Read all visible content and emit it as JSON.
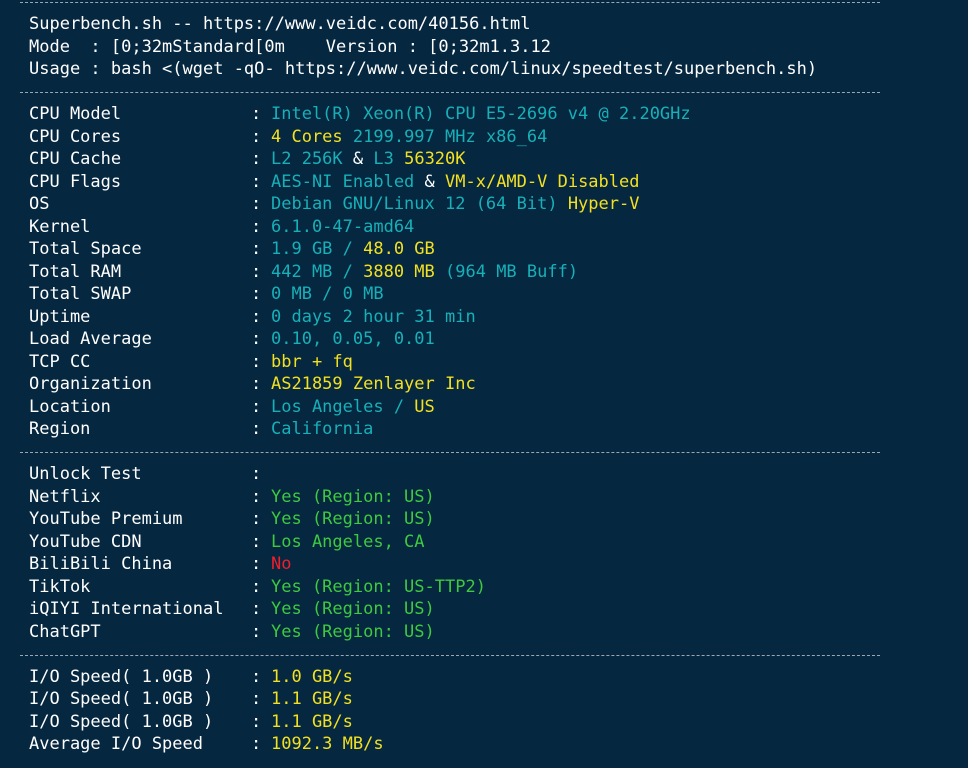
{
  "colors": {
    "background": "#052740",
    "cyan": "#17b0b8",
    "yellow": "#f2e021",
    "green": "#3fc93f",
    "red": "#ef1f2b"
  },
  "header": {
    "title": "Superbench.sh -- https://www.veidc.com/40156.html",
    "mode": "Mode  : [0;32mStandard[0m    Version : [0;32m1.3.12",
    "usage": "Usage : bash <(wget -qO- https://www.veidc.com/linux/speedtest/superbench.sh)"
  },
  "system": {
    "cpu_model": {
      "label": "CPU Model",
      "value": "Intel(R) Xeon(R) CPU E5-2696 v4 @ 2.20GHz"
    },
    "cpu_cores": {
      "label": "CPU Cores",
      "cores": "4 Cores",
      "rest": " 2199.997 MHz x86_64"
    },
    "cpu_cache": {
      "label": "CPU Cache",
      "l2": "L2 256K",
      "amp": " & ",
      "l3_prefix": "L3 ",
      "l3": "56320K"
    },
    "cpu_flags": {
      "label": "CPU Flags",
      "aes": "AES-NI Enabled",
      "amp": " & ",
      "vm": "VM-x/AMD-V Disabled"
    },
    "os": {
      "label": "OS",
      "value": "Debian GNU/Linux 12 (64 Bit)",
      "virt": " Hyper-V"
    },
    "kernel": {
      "label": "Kernel",
      "value": "6.1.0-47-amd64"
    },
    "total_space": {
      "label": "Total Space",
      "used": "1.9 GB / ",
      "total": "48.0 GB"
    },
    "total_ram": {
      "label": "Total RAM",
      "used": "442 MB / ",
      "total": "3880 MB",
      "buff": " (964 MB Buff)"
    },
    "total_swap": {
      "label": "Total SWAP",
      "value": "0 MB / 0 MB"
    },
    "uptime": {
      "label": "Uptime",
      "value": "0 days 2 hour 31 min"
    },
    "load_average": {
      "label": "Load Average",
      "value": "0.10, 0.05, 0.01"
    },
    "tcp_cc": {
      "label": "TCP CC",
      "value": "bbr + fq"
    },
    "organization": {
      "label": "Organization",
      "value": "AS21859 Zenlayer Inc"
    },
    "location": {
      "label": "Location",
      "city": "Los Angeles / ",
      "country": "US"
    },
    "region": {
      "label": "Region",
      "value": "California"
    }
  },
  "unlock": {
    "heading": {
      "label": "Unlock Test"
    },
    "netflix": {
      "label": "Netflix",
      "value": "Yes (Region: US)"
    },
    "youtube_premium": {
      "label": "YouTube Premium",
      "value": "Yes (Region: US)"
    },
    "youtube_cdn": {
      "label": "YouTube CDN",
      "value": "Los Angeles, CA"
    },
    "bilibili": {
      "label": "BiliBili China",
      "value": "No"
    },
    "tiktok": {
      "label": "TikTok",
      "value": "Yes (Region: US-TTP2)"
    },
    "iqiyi": {
      "label": "iQIYI International",
      "value": "Yes (Region: US)"
    },
    "chatgpt": {
      "label": "ChatGPT",
      "value": "Yes (Region: US)"
    }
  },
  "io": {
    "run1": {
      "label": "I/O Speed( 1.0GB )",
      "value": "1.0 GB/s"
    },
    "run2": {
      "label": "I/O Speed( 1.0GB )",
      "value": "1.1 GB/s"
    },
    "run3": {
      "label": "I/O Speed( 1.0GB )",
      "value": "1.1 GB/s"
    },
    "average": {
      "label": "Average I/O Speed",
      "value": "1092.3 MB/s"
    }
  },
  "separator": ":"
}
